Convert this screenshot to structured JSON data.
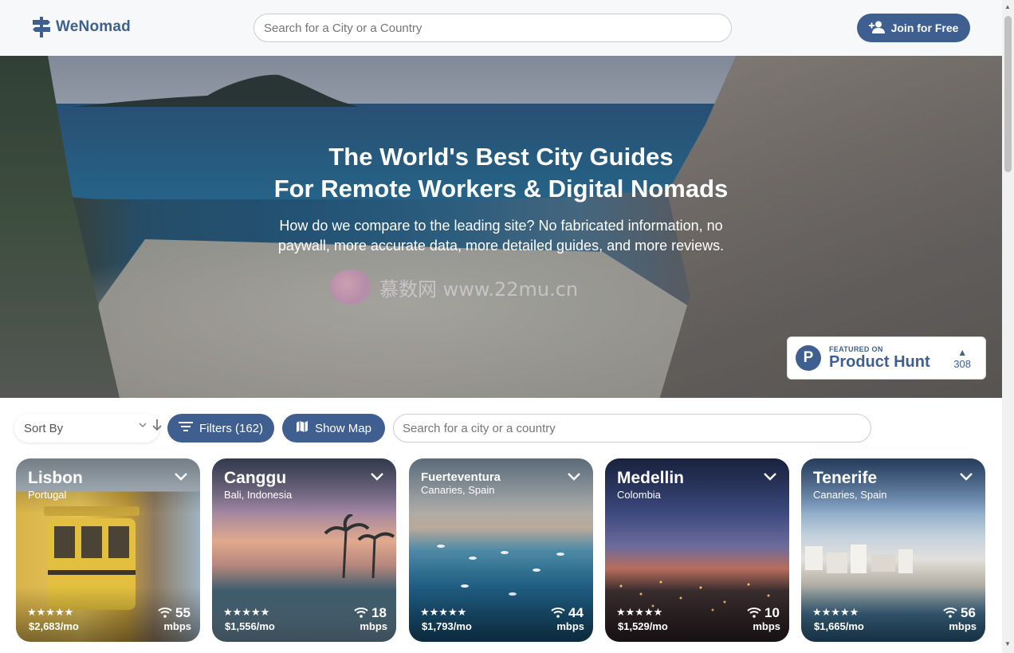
{
  "header": {
    "brand": "WeNomad",
    "search_placeholder": "Search for a City or a Country",
    "join_label": "Join for Free"
  },
  "hero": {
    "title_line1": "The World's Best City Guides",
    "title_line2": "For Remote Workers & Digital Nomads",
    "subtitle_line1": "How do we compare to the leading site? No fabricated information, no",
    "subtitle_line2": "paywall, more accurate data, more detailed guides, and more reviews.",
    "watermark": "慕数网 www.22mu.cn"
  },
  "product_hunt": {
    "letter": "P",
    "small": "FEATURED ON",
    "big": "Product Hunt",
    "arrow": "▲",
    "votes": "308"
  },
  "toolbar": {
    "sort_label": "Sort By",
    "filters_label": "Filters (162)",
    "map_label": "Show Map",
    "search_placeholder": "Search for a city or a country"
  },
  "cities": [
    {
      "name": "Lisbon",
      "country": "Portugal",
      "rating": "★★★★★",
      "price": "$2,683/mo",
      "speed": "55",
      "unit": "mbps"
    },
    {
      "name": "Canggu",
      "country": "Bali, Indonesia",
      "rating": "★★★★★",
      "price": "$1,556/mo",
      "speed": "18",
      "unit": "mbps"
    },
    {
      "name": "Fuerteventura",
      "country": "Canaries, Spain",
      "rating": "★★★★★",
      "price": "$1,793/mo",
      "speed": "44",
      "unit": "mbps"
    },
    {
      "name": "Medellin",
      "country": "Colombia",
      "rating": "★★★★★",
      "price": "$1,529/mo",
      "speed": "10",
      "unit": "mbps"
    },
    {
      "name": "Tenerife",
      "country": "Canaries, Spain",
      "rating": "★★★★★",
      "price": "$1,665/mo",
      "speed": "56",
      "unit": "mbps"
    }
  ],
  "colors": {
    "brand": "#3e5f8f",
    "placeholder": "#aab0b9"
  },
  "scroll": {
    "up": "▲",
    "down": "▼"
  }
}
